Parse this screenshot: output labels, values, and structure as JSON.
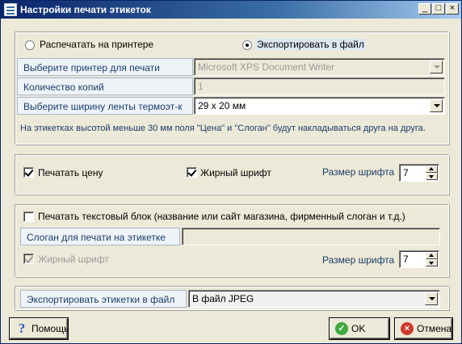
{
  "window": {
    "title": "Настройки печати этикеток",
    "minimize_glyph": "_",
    "maximize_glyph": "□",
    "close_glyph": "×"
  },
  "output_mode": {
    "print_label": "Распечатать на принтере",
    "export_label": "Экспортировать в файл",
    "selected": "export"
  },
  "printer": {
    "label": "Выберите принтер для печати",
    "value": "Microsoft XPS Document Writer"
  },
  "copies": {
    "label": "Количество копий",
    "value": "1"
  },
  "tape": {
    "label": "Выберите ширину ленты термоэт-к",
    "value": "29 x 20 мм"
  },
  "note": "На этикетках высотой меньше 30 мм поля \"Цена\" и \"Слоган\" будут накладываться друга на друга.",
  "price_section": {
    "print_price_label": "Печатать цену",
    "print_price_checked": true,
    "bold_label": "Жирный шрифт",
    "bold_checked": true,
    "font_size_label": "Размер шрифта",
    "font_size_value": "7"
  },
  "text_block": {
    "print_text_label": "Печатать текстовый блок (название или сайт магазина, фирменный слоган и т.д.)",
    "print_text_checked": false,
    "slogan_label": "Слоган для печати на этикетке",
    "slogan_value": "",
    "bold_label": "Жирный шрифт",
    "bold_checked": true,
    "font_size_label": "Размер шрифта",
    "font_size_value": "7"
  },
  "export": {
    "label": "Экспортировать этикетки в файл",
    "value": "В файл JPEG"
  },
  "buttons": {
    "help": "Помощь",
    "ok": "OK",
    "cancel": "Отмена"
  }
}
